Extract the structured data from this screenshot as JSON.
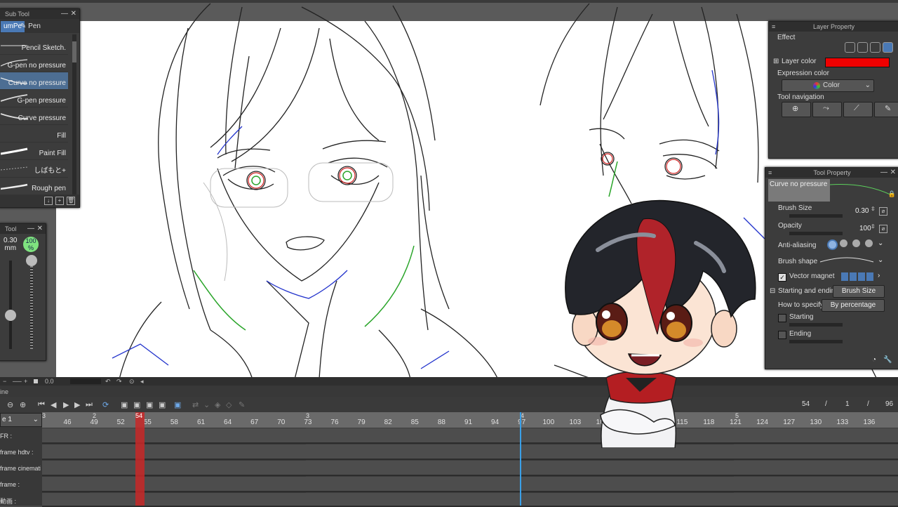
{
  "subtool": {
    "title": "Sub Tool",
    "tabs": [
      "umPe",
      "Pen"
    ],
    "items": [
      {
        "label": "Pencil Sketch."
      },
      {
        "label": "G-pen no pressure"
      },
      {
        "label": "Curve no pressure"
      },
      {
        "label": "G-pen pressure"
      },
      {
        "label": "Curve pressure"
      },
      {
        "label": "Fill"
      },
      {
        "label": "Paint Fill"
      },
      {
        "label": "しばもと+"
      },
      {
        "label": "Rough pen"
      }
    ]
  },
  "toolsize": {
    "title": "Tool",
    "size_value": "0.30",
    "size_unit": "mm",
    "opacity_value": "100",
    "opacity_unit": "%"
  },
  "canvas_status": {
    "zoom": "0.0"
  },
  "layer_property": {
    "title": "Layer Property",
    "effect_label": "Effect",
    "layer_color_label": "Layer color",
    "layer_color": "#ee0000",
    "expression_color_label": "Expression color",
    "expression_color_value": "Color",
    "tool_navigation_label": "Tool navigation"
  },
  "tool_property": {
    "title": "Tool Property",
    "preset_name": "Curve no pressure",
    "brush_size_label": "Brush Size",
    "brush_size_value": "0.30",
    "opacity_label": "Opacity",
    "opacity_value": "100",
    "anti_aliasing_label": "Anti-aliasing",
    "brush_shape_label": "Brush shape",
    "vector_magnet_label": "Vector magnet",
    "start_end_label": "Starting and ending",
    "start_end_value": "Brush Size",
    "how_to_specify_label": "How to specify",
    "how_to_specify_value": "By percentage",
    "starting_label": "Starting",
    "ending_label": "Ending"
  },
  "timeline": {
    "title": "ine",
    "track_select": "e 1",
    "current_frame": "54",
    "sep1": "/",
    "start_frame": "1",
    "sep2": "/",
    "end_frame": "96",
    "ruler_ticks": [
      "46",
      "49",
      "52",
      "55",
      "58",
      "61",
      "64",
      "67",
      "70",
      "73",
      "76",
      "79",
      "82",
      "85",
      "88",
      "91",
      "94",
      "97",
      "100",
      "103",
      "106",
      "109",
      "112",
      "115",
      "118",
      "121",
      "124",
      "127",
      "130",
      "133",
      "136"
    ],
    "ruler_top_marks": [
      "3",
      "2",
      "54",
      "3",
      "4",
      "5"
    ],
    "playhead_label": "54",
    "tracks": [
      {
        "name": "FR :"
      },
      {
        "name": "frame hdtv :"
      },
      {
        "name": "frame cinematic :"
      },
      {
        "name": "frame :"
      },
      {
        "name": "動画 :"
      }
    ]
  },
  "colors": {
    "accent_blue": "#4a79b5",
    "playhead": "#c82828",
    "end_marker": "#3aa0e8",
    "opacity_badge": "#7fe37f"
  }
}
